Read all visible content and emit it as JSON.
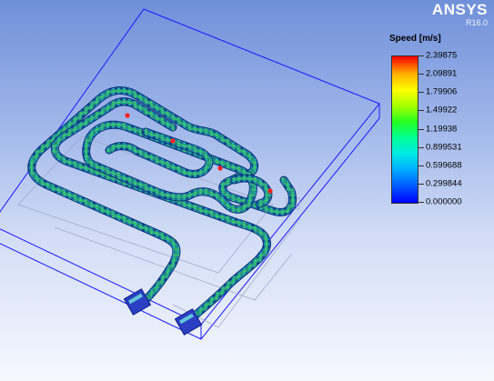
{
  "brand": {
    "name": "ANSYS",
    "version": "R16.0"
  },
  "legend": {
    "title": "Speed [m/s]",
    "values": [
      "2.39875",
      "2.09891",
      "1.79906",
      "1.49922",
      "1.19938",
      "0.899531",
      "0.599688",
      "0.299844",
      "0.000000"
    ],
    "colormap": [
      "#0000ff",
      "#0057ff",
      "#00a8ff",
      "#00e8e8",
      "#00ff9a",
      "#22ff22",
      "#a4ff00",
      "#ffff00",
      "#ffb000",
      "#ff0000"
    ]
  },
  "colors": {
    "viewport_top": "#6f8fd8",
    "viewport_bottom": "#f6f8fe",
    "domain_edge": "#1a1aff",
    "pipe_base": "#0a3a8a",
    "pipe_mid": "#1aa6a8",
    "pipe_high": "#39d24a",
    "hot_spot": "#ff2222"
  }
}
